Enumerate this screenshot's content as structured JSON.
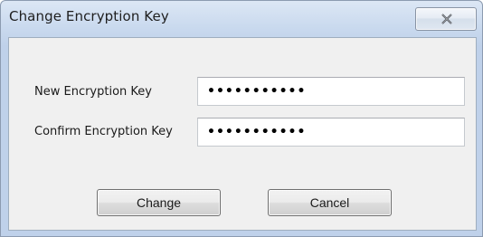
{
  "window": {
    "title": "Change Encryption Key"
  },
  "close_button": {
    "icon": "close-icon"
  },
  "form": {
    "new_key": {
      "label": "New Encryption Key",
      "value": "•••••••••••"
    },
    "confirm_key": {
      "label": "Confirm Encryption Key",
      "value": "•••••••••••"
    }
  },
  "buttons": {
    "change_label": "Change",
    "cancel_label": "Cancel"
  }
}
